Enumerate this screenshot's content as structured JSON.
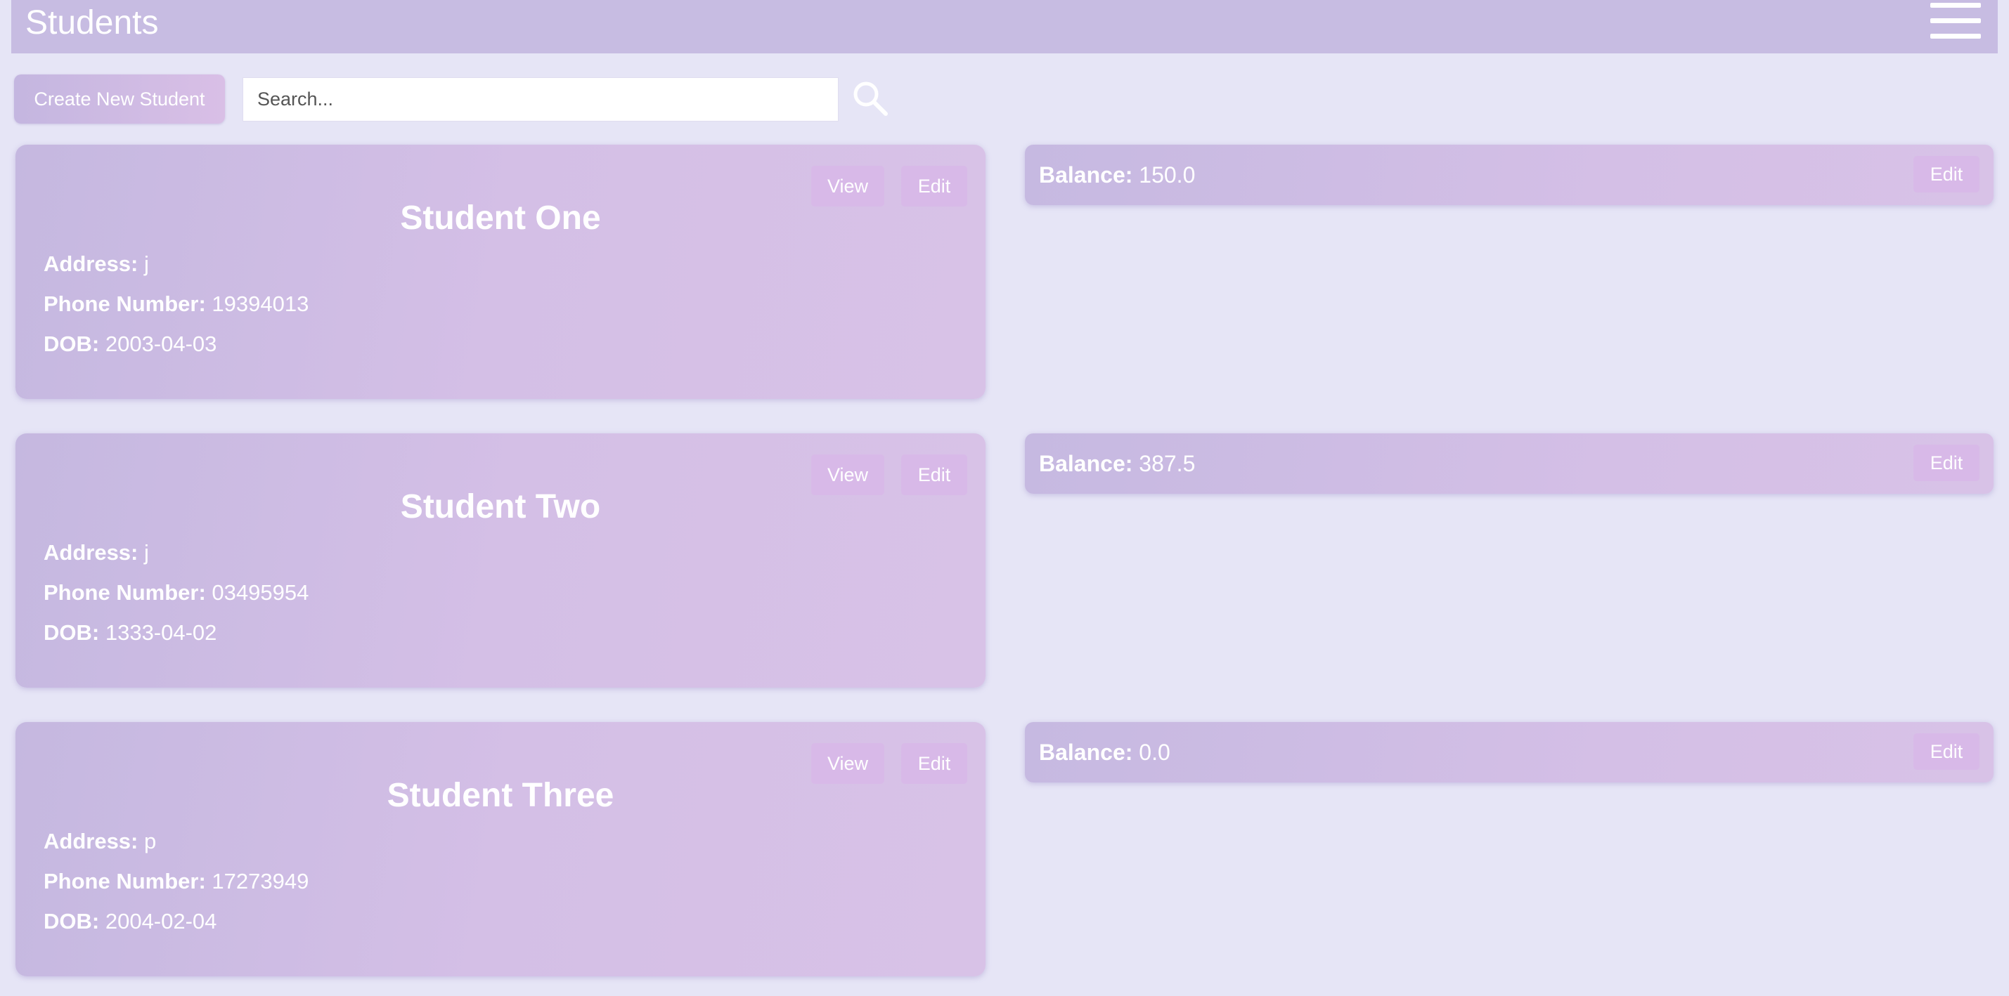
{
  "header": {
    "title": "Students",
    "menu_icon": "hamburger-menu-icon"
  },
  "toolbar": {
    "create_label": "Create New Student",
    "search_placeholder": "Search...",
    "search_value": "",
    "search_icon": "search-icon"
  },
  "labels": {
    "view": "View",
    "edit": "Edit",
    "address": "Address:",
    "phone": "Phone Number:",
    "dob": "DOB:",
    "balance": "Balance:"
  },
  "students": [
    {
      "name": "Student One",
      "address": "j",
      "phone": "19394013",
      "dob": "2003-04-03",
      "balance": "150.0"
    },
    {
      "name": "Student Two",
      "address": "j",
      "phone": "03495954",
      "dob": "1333-04-02",
      "balance": "387.5"
    },
    {
      "name": "Student Three",
      "address": "p",
      "phone": "17273949",
      "dob": "2004-02-04",
      "balance": "0.0"
    }
  ],
  "colors": {
    "background": "#e6e5f6",
    "header": "#c7bce2",
    "card_start": "#c5b8e0",
    "card_end": "#d8c2e7",
    "button": "#d8b9e8",
    "text": "#ffffff"
  }
}
